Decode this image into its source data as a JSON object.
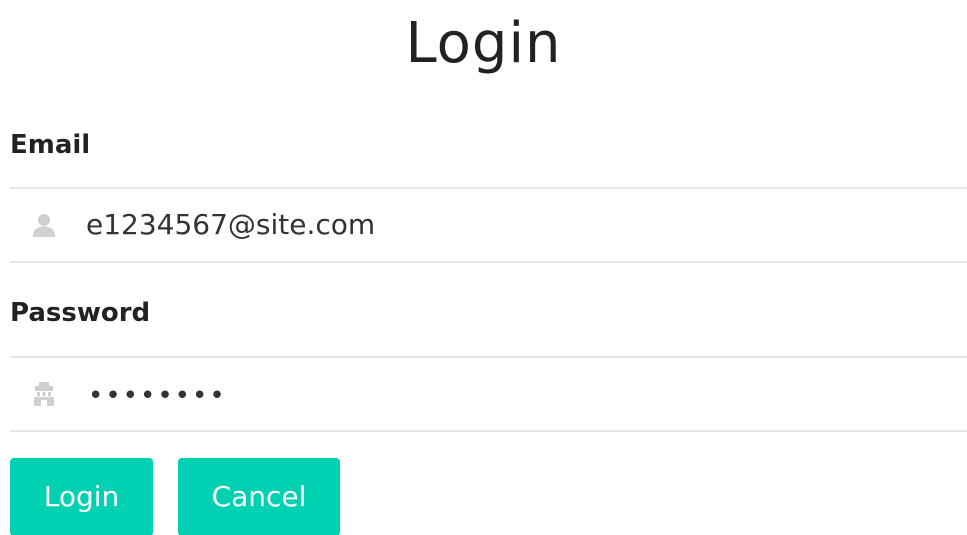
{
  "form": {
    "title": "Login",
    "email": {
      "label": "Email",
      "value": "e1234567@site.com",
      "icon": "user-icon"
    },
    "password": {
      "label": "Password",
      "masked_value": "••••••••",
      "icon": "lock-icon"
    },
    "buttons": {
      "login_label": "Login",
      "cancel_label": "Cancel"
    }
  },
  "colors": {
    "primary": "#00d1b2",
    "border": "#e6e6e6",
    "icon": "#d0d0d0"
  }
}
